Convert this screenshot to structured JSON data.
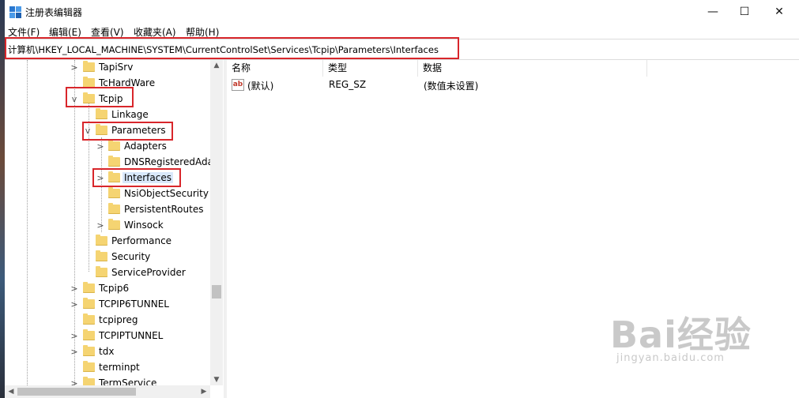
{
  "window": {
    "title": "注册表编辑器",
    "minimize": "—",
    "maximize": "☐",
    "close": "✕"
  },
  "menu": [
    "文件(F)",
    "编辑(E)",
    "查看(V)",
    "收藏夹(A)",
    "帮助(H)"
  ],
  "address": "计算机\\HKEY_LOCAL_MACHINE\\SYSTEM\\CurrentControlSet\\Services\\Tcpip\\Parameters\\Interfaces",
  "tree": [
    {
      "label": "TapiSrv",
      "level": 0,
      "chevron": ">"
    },
    {
      "label": "TcHardWare",
      "level": 0,
      "chevron": ""
    },
    {
      "label": "Tcpip",
      "level": 0,
      "chevron": "v"
    },
    {
      "label": "Linkage",
      "level": 1,
      "chevron": ""
    },
    {
      "label": "Parameters",
      "level": 1,
      "chevron": "v"
    },
    {
      "label": "Adapters",
      "level": 2,
      "chevron": ">"
    },
    {
      "label": "DNSRegisteredAda",
      "level": 2,
      "chevron": ""
    },
    {
      "label": "Interfaces",
      "level": 2,
      "chevron": ">",
      "selected": true
    },
    {
      "label": "NsiObjectSecurity",
      "level": 2,
      "chevron": ""
    },
    {
      "label": "PersistentRoutes",
      "level": 2,
      "chevron": ""
    },
    {
      "label": "Winsock",
      "level": 2,
      "chevron": ">"
    },
    {
      "label": "Performance",
      "level": 1,
      "chevron": ""
    },
    {
      "label": "Security",
      "level": 1,
      "chevron": ""
    },
    {
      "label": "ServiceProvider",
      "level": 1,
      "chevron": ""
    },
    {
      "label": "Tcpip6",
      "level": 0,
      "chevron": ">"
    },
    {
      "label": "TCPIP6TUNNEL",
      "level": 0,
      "chevron": ">"
    },
    {
      "label": "tcpipreg",
      "level": 0,
      "chevron": ""
    },
    {
      "label": "TCPIPTUNNEL",
      "level": 0,
      "chevron": ">"
    },
    {
      "label": "tdx",
      "level": 0,
      "chevron": ">"
    },
    {
      "label": "terminpt",
      "level": 0,
      "chevron": ""
    },
    {
      "label": "TermService",
      "level": 0,
      "chevron": ">"
    }
  ],
  "columns": [
    "名称",
    "类型",
    "数据"
  ],
  "values": [
    {
      "icon": "ab",
      "name": "(默认)",
      "type": "REG_SZ",
      "data": "(数值未设置)"
    }
  ],
  "watermark": {
    "brand": "Bai经验",
    "sub": "jingyan.baidu.com"
  },
  "colors": {
    "highlight": "#d8262b",
    "folder": "#f5d472",
    "selection": "#d9e8fb"
  }
}
